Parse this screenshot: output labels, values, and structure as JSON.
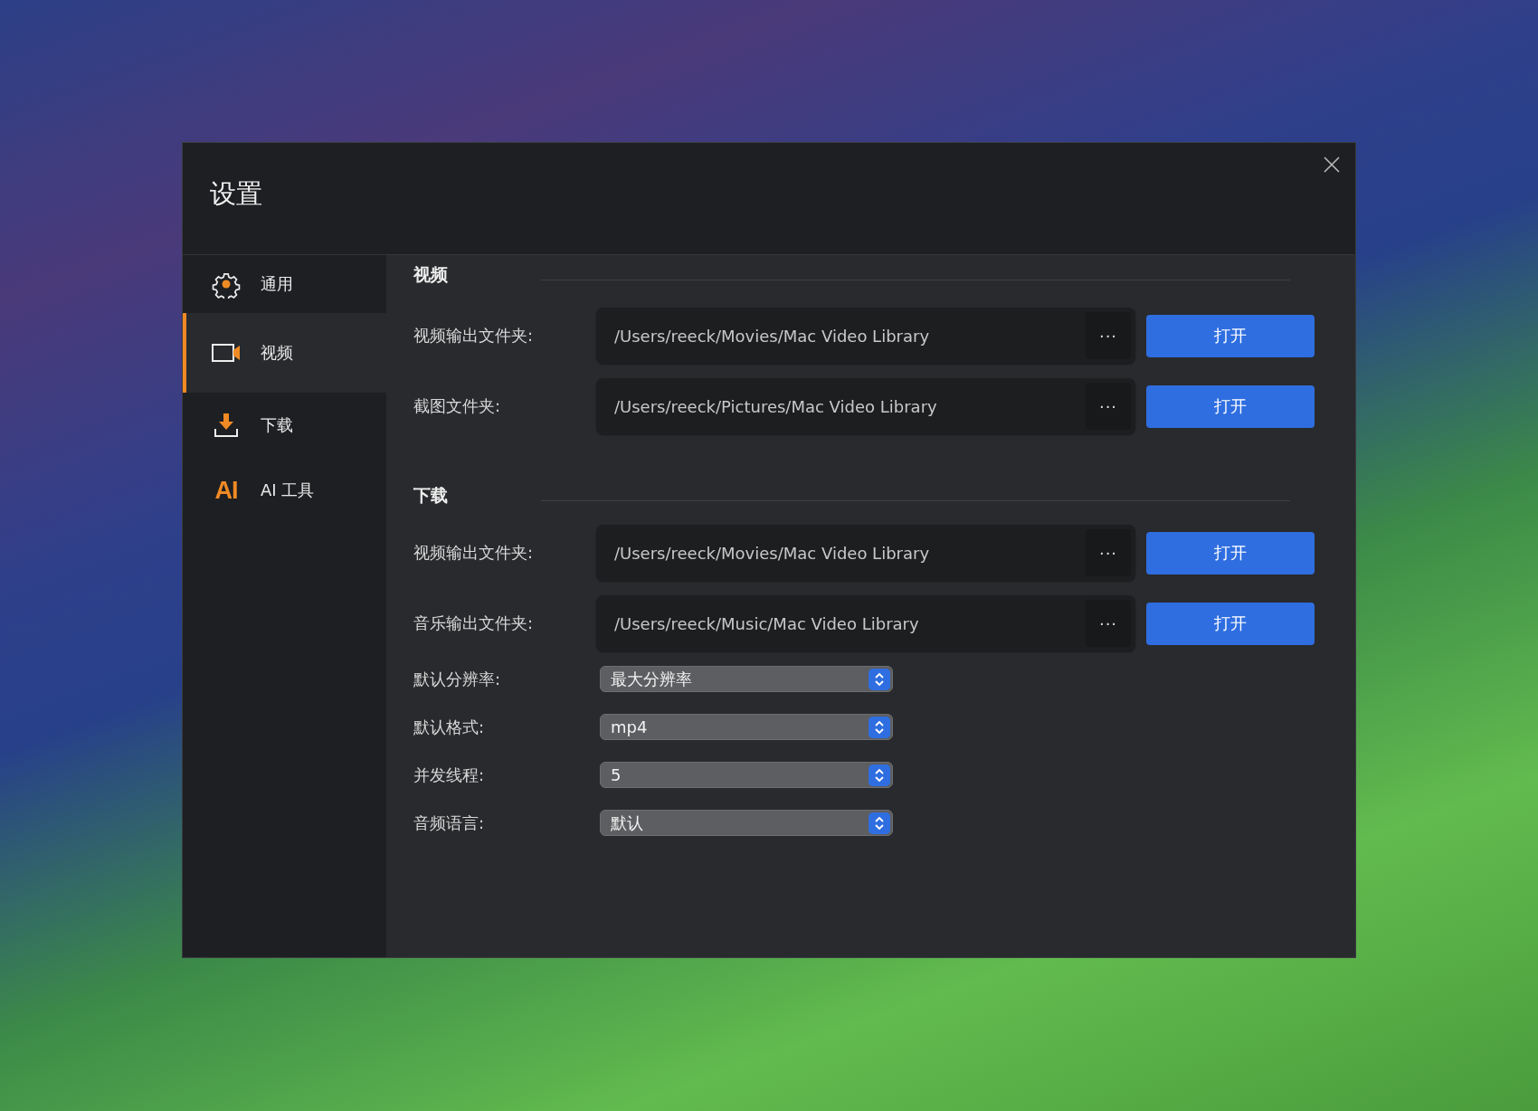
{
  "window": {
    "title": "设置"
  },
  "sidebar": {
    "items": [
      {
        "label": "通用",
        "selected": false
      },
      {
        "label": "视频",
        "selected": true
      },
      {
        "label": "下载",
        "selected": false
      },
      {
        "label": "AI 工具",
        "selected": false,
        "logo": "AI"
      }
    ]
  },
  "sections": [
    {
      "title": "视频",
      "rows": [
        {
          "kind": "path",
          "label": "视频输出文件夹:",
          "value": "/Users/reeck/Movies/Mac Video Library",
          "browse": "···",
          "button": "打开"
        },
        {
          "kind": "path",
          "label": "截图文件夹:",
          "value": "/Users/reeck/Pictures/Mac Video Library",
          "browse": "···",
          "button": "打开"
        }
      ]
    },
    {
      "title": "下载",
      "rows": [
        {
          "kind": "path",
          "label": "视频输出文件夹:",
          "value": "/Users/reeck/Movies/Mac Video Library",
          "browse": "···",
          "button": "打开"
        },
        {
          "kind": "path",
          "label": "音乐输出文件夹:",
          "value": "/Users/reeck/Music/Mac Video Library",
          "browse": "···",
          "button": "打开"
        },
        {
          "kind": "select",
          "label": "默认分辨率:",
          "value": "最大分辨率"
        },
        {
          "kind": "select",
          "label": "默认格式:",
          "value": "mp4"
        },
        {
          "kind": "select",
          "label": "并发线程:",
          "value": "5"
        },
        {
          "kind": "select",
          "label": "音频语言:",
          "value": "默认"
        }
      ]
    }
  ]
}
